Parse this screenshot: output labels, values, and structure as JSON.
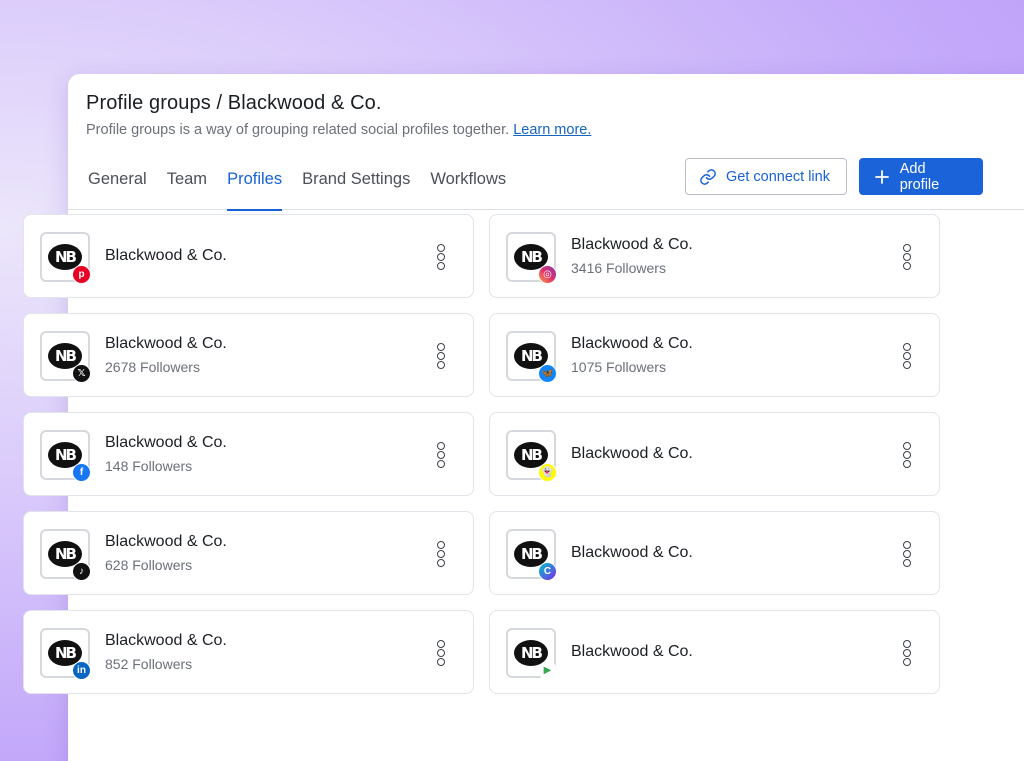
{
  "header": {
    "title": "Profile groups / Blackwood & Co.",
    "subtitle": "Profile groups is a way of grouping related social profiles together.",
    "learn_more": "Learn more."
  },
  "tabs": [
    {
      "label": "General",
      "active": false
    },
    {
      "label": "Team",
      "active": false
    },
    {
      "label": "Profiles",
      "active": true
    },
    {
      "label": "Brand Settings",
      "active": false
    },
    {
      "label": "Workflows",
      "active": false
    }
  ],
  "actions": {
    "connect_label": "Get connect link",
    "add_label": "Add profile"
  },
  "logo_text": "NB",
  "colors": {
    "accent": "#1762d6",
    "primary_button": "#1a63d8"
  },
  "profiles": [
    {
      "name": "Blackwood & Co.",
      "followers": "",
      "network": "pinterest-icon"
    },
    {
      "name": "Blackwood & Co.",
      "followers": "3416 Followers",
      "network": "instagram-icon"
    },
    {
      "name": "Blackwood & Co.",
      "followers": "2678 Followers",
      "network": "x-icon"
    },
    {
      "name": "Blackwood & Co.",
      "followers": "1075 Followers",
      "network": "bluesky-icon"
    },
    {
      "name": "Blackwood & Co.",
      "followers": "148 Followers",
      "network": "facebook-icon"
    },
    {
      "name": "Blackwood & Co.",
      "followers": "",
      "network": "snapchat-icon"
    },
    {
      "name": "Blackwood & Co.",
      "followers": "628 Followers",
      "network": "tiktok-icon"
    },
    {
      "name": "Blackwood & Co.",
      "followers": "",
      "network": "canva-icon"
    },
    {
      "name": "Blackwood & Co.",
      "followers": "852 Followers",
      "network": "linkedin-icon"
    },
    {
      "name": "Blackwood & Co.",
      "followers": "",
      "network": "google-play-icon"
    }
  ]
}
